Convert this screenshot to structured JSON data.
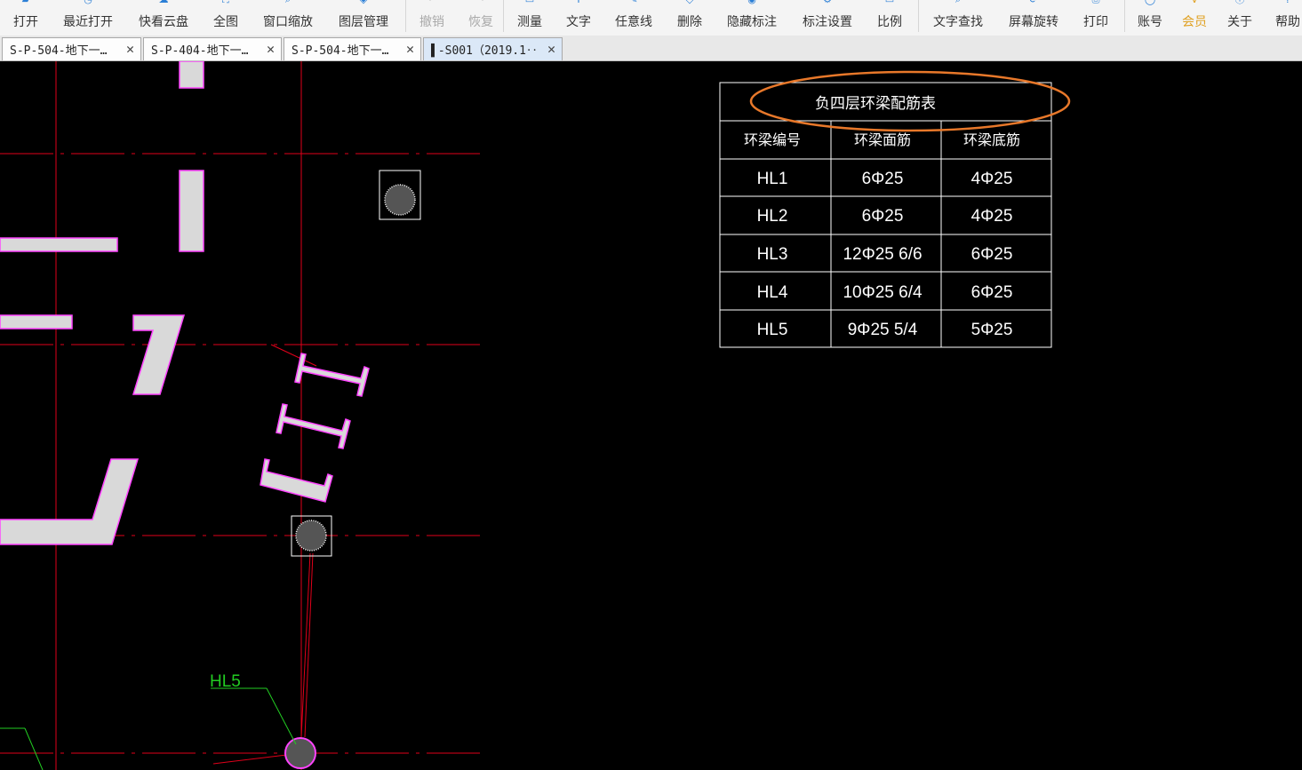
{
  "toolbar": {
    "items": [
      {
        "label": "打开",
        "icon": "folder-open-icon"
      },
      {
        "label": "最近打开",
        "icon": "recent-icon"
      },
      {
        "label": "快看云盘",
        "icon": "cloud-icon"
      },
      {
        "label": "全图",
        "icon": "fit-view-icon"
      },
      {
        "label": "窗口缩放",
        "icon": "zoom-window-icon"
      },
      {
        "label": "图层管理",
        "icon": "layers-icon"
      },
      {
        "label": "撤销",
        "icon": "undo-icon"
      },
      {
        "label": "恢复",
        "icon": "redo-icon"
      },
      {
        "label": "测量",
        "icon": "ruler-icon"
      },
      {
        "label": "文字",
        "icon": "text-icon"
      },
      {
        "label": "任意线",
        "icon": "pen-icon"
      },
      {
        "label": "删除",
        "icon": "eraser-icon"
      },
      {
        "label": "隐藏标注",
        "icon": "eye-icon"
      },
      {
        "label": "标注设置",
        "icon": "gear-icon"
      },
      {
        "label": "比例",
        "icon": "scale-icon"
      },
      {
        "label": "文字查找",
        "icon": "search-text-icon"
      },
      {
        "label": "屏幕旋转",
        "icon": "rotate-icon"
      },
      {
        "label": "打印",
        "icon": "printer-icon"
      },
      {
        "label": "账号",
        "icon": "user-icon"
      },
      {
        "label": "会员",
        "icon": "vip-icon"
      },
      {
        "label": "关于",
        "icon": "info-icon"
      },
      {
        "label": "帮助",
        "icon": "help-icon"
      }
    ]
  },
  "tabs": [
    {
      "label": "S-P-504-地下一…"
    },
    {
      "label": "S-P-404-地下一…"
    },
    {
      "label": "S-P-504-地下一…"
    },
    {
      "label": "▌-S001（2019.1‥"
    }
  ],
  "tab_close_glyph": "✕",
  "drawing": {
    "table": {
      "title": "负四层环梁配筋表",
      "headers": [
        "环梁编号",
        "环梁面筋",
        "环梁底筋"
      ],
      "rows": [
        [
          "HL1",
          "6Φ25",
          "4Φ25"
        ],
        [
          "HL2",
          "6Φ25",
          "4Φ25"
        ],
        [
          "HL3",
          "12Φ25 6/6",
          "6Φ25"
        ],
        [
          "HL4",
          "10Φ25 6/4",
          "6Φ25"
        ],
        [
          "HL5",
          "9Φ25 5/4",
          "5Φ25"
        ]
      ]
    },
    "beam_label": "HL5"
  },
  "colors": {
    "background": "#000000",
    "grid_line": "#e0001a",
    "wall_fill": "#d9d9d9",
    "wall_outline": "#ff44ff",
    "table_line": "#ffffff",
    "label_green": "#22cc22",
    "highlight_ellipse": "#e8782a",
    "accent_blue": "#2b7fd6"
  }
}
